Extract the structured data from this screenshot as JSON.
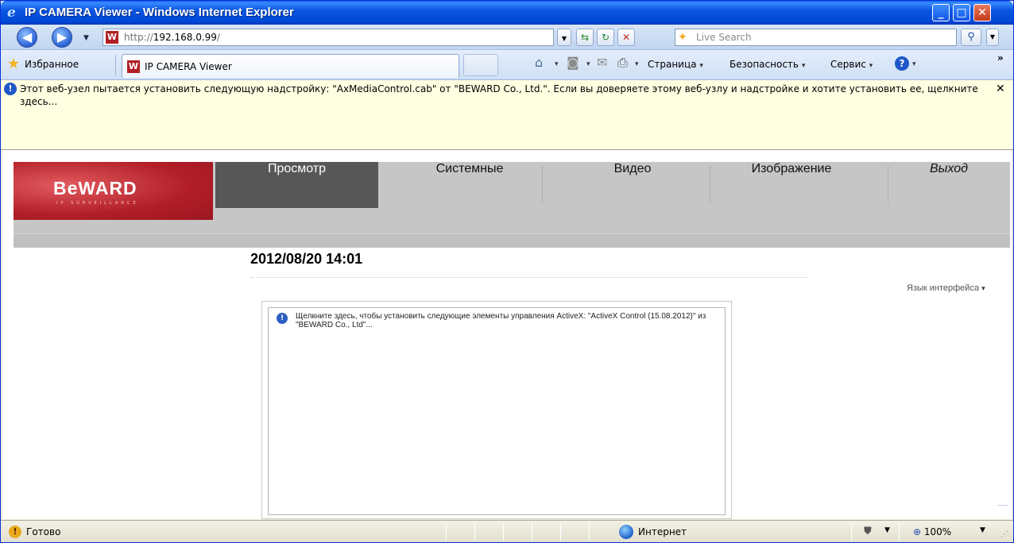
{
  "window": {
    "title": "IP CAMERA Viewer - Windows Internet Explorer",
    "minimize_glyph": "_",
    "maximize_glyph": "□",
    "close_glyph": "✕"
  },
  "toolbar": {
    "back_glyph": "◀",
    "forward_glyph": "▶",
    "dropdown_glyph": "▼",
    "address_scheme": "http://",
    "address_host": "192.168.0.99",
    "address_path": "/",
    "refresh_glyph": "↻",
    "stop_glyph": "✕",
    "compat_glyph": "⇆",
    "search_placeholder": "Live Search",
    "search_glyph": "⚲"
  },
  "favorites_bar": {
    "favorites_label": "Избранное",
    "tab_label": "IP CAMERA Viewer",
    "home_glyph": "⌂",
    "feeds_glyph": "◙",
    "mail_glyph": "✉",
    "print_glyph": "⎙",
    "page_menu": "Страница",
    "safety_menu": "Безопасность",
    "tools_menu": "Сервис",
    "help_glyph": "?",
    "overflow_glyph": "»",
    "caret": "▾"
  },
  "infobar": {
    "text": "Этот веб-узел пытается установить следующую надстройку: \"AxMediaControl.cab\" от \"BEWARD Co., Ltd.\". Если вы доверяете этому веб-узлу и надстройке и хотите установить ее, щелкните здесь...",
    "close_glyph": "✕"
  },
  "page": {
    "logo_text": "BeWARD",
    "logo_subtext": "IP SURVEILLANCE",
    "nav": [
      {
        "label": "Просмотр",
        "active": true
      },
      {
        "label": "Системные",
        "active": false
      },
      {
        "label": "Видео",
        "active": false
      },
      {
        "label": "Изображение",
        "active": false
      },
      {
        "label": "Выход",
        "active": false
      }
    ],
    "datetime": "2012/08/20 14:01",
    "language_link": "Язык интерфейса",
    "activex_message": "Щелкните здесь, чтобы установить следующие элементы управления ActiveX: \"ActiveX Control (15.08.2012)\" из \"BEWARD Co., Ltd\"..."
  },
  "statusbar": {
    "status": "Готово",
    "zone": "Интернет",
    "zoom": "100%",
    "dropdown_glyph": "▼"
  },
  "colors": {
    "titlebar": "#0a56e2",
    "logo_red": "#b21e28",
    "nav_active": "#575757",
    "nav_band": "#c6c6c6",
    "infobar": "#ffffe1"
  }
}
